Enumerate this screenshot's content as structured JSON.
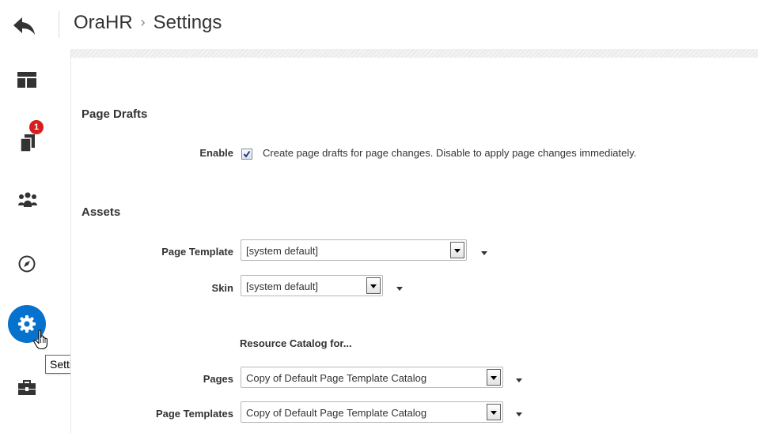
{
  "header": {
    "back_icon": "back-arrow-icon",
    "app_name": "OraHR",
    "separator": "›",
    "page_name": "Settings"
  },
  "sidebar": {
    "items": [
      {
        "icon": "layout-icon"
      },
      {
        "icon": "documents-icon",
        "badge": "1"
      },
      {
        "icon": "people-icon"
      },
      {
        "icon": "compass-icon"
      },
      {
        "icon": "gear-icon",
        "active": true
      },
      {
        "icon": "toolbox-icon"
      }
    ],
    "tooltip": "Settings"
  },
  "page_drafts": {
    "title": "Page Drafts",
    "enable_label": "Enable",
    "enable_checked": true,
    "enable_text": "Create page drafts for page changes. Disable to apply page changes immediately."
  },
  "assets": {
    "title": "Assets",
    "page_template_label": "Page Template",
    "page_template_value": "[system default]",
    "skin_label": "Skin",
    "skin_value": "[system default]",
    "resource_catalog_heading": "Resource Catalog for...",
    "pages_label": "Pages",
    "pages_value": "Copy of Default Page Template Catalog",
    "page_templates_label": "Page Templates",
    "page_templates_value": "Copy of Default Page Template Catalog"
  },
  "colors": {
    "accent": "#0572ce",
    "badge": "#d61e1e",
    "icon": "#333333"
  }
}
